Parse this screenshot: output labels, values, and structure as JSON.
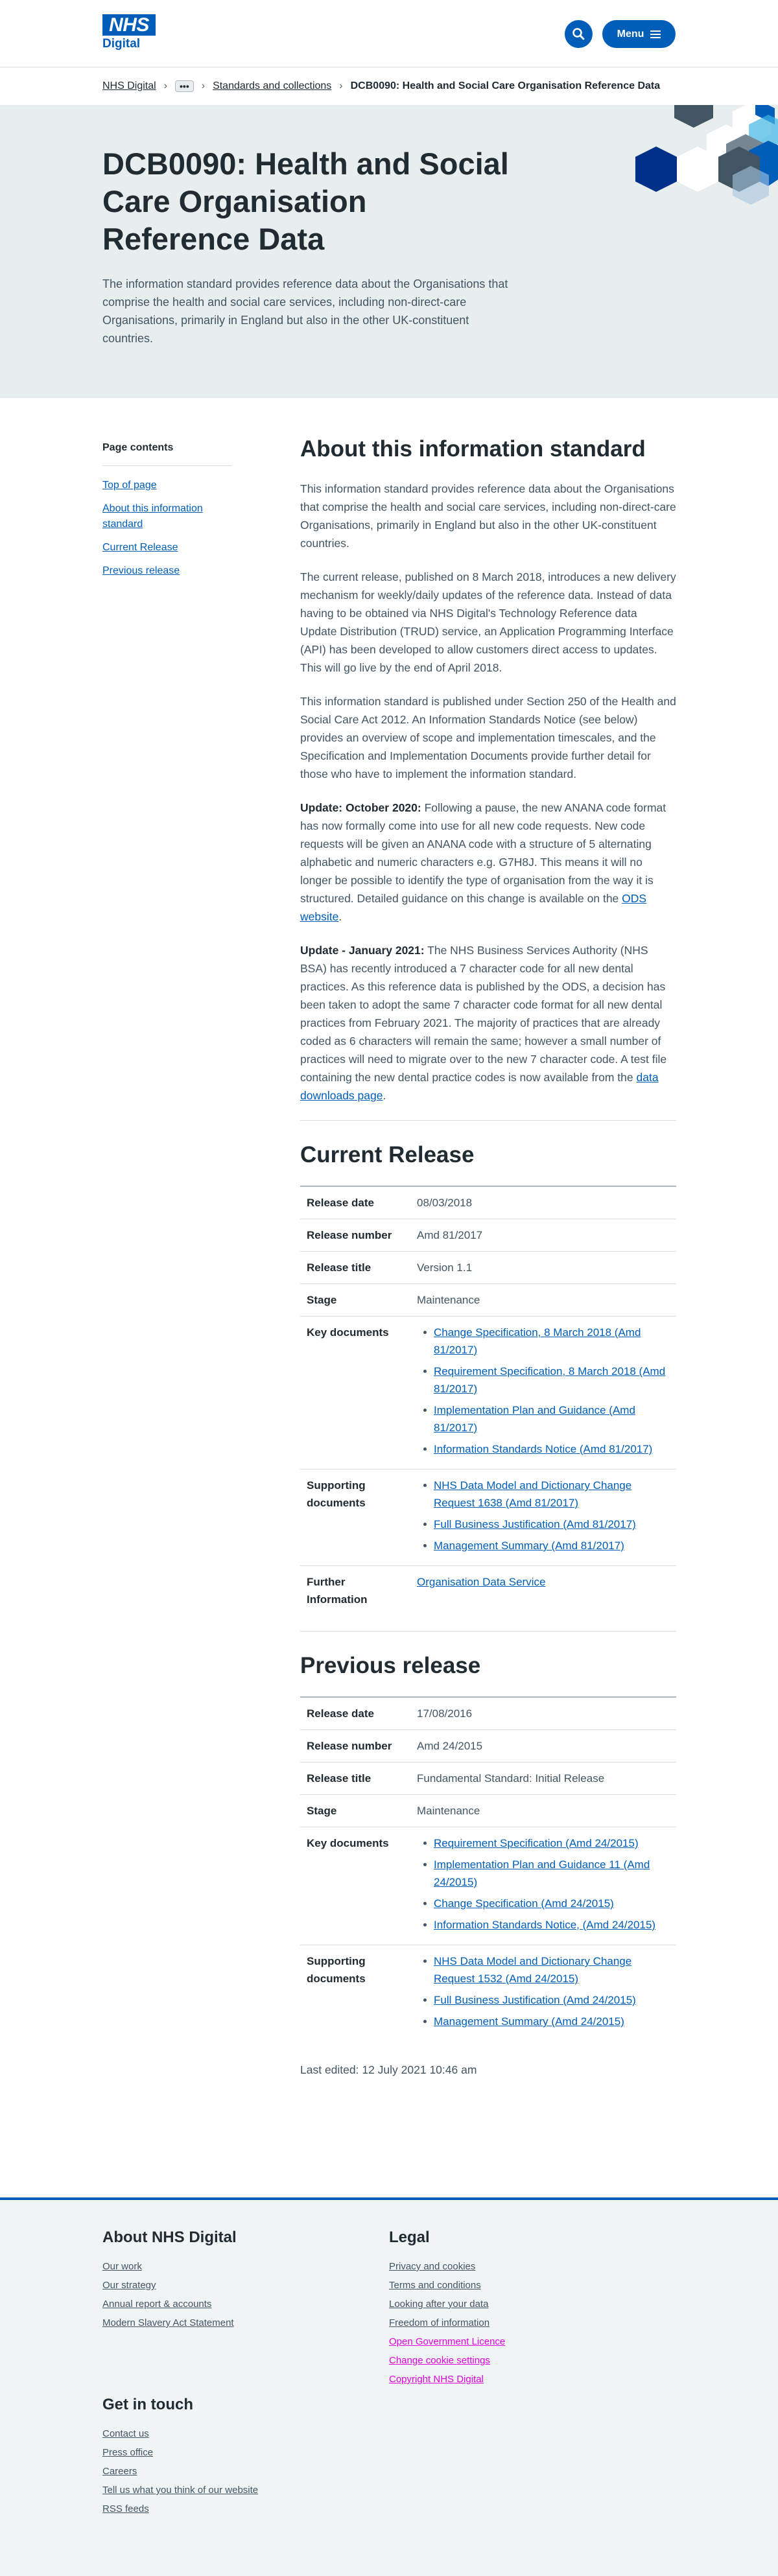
{
  "header": {
    "logo_text": "NHS",
    "logo_sub": "Digital",
    "menu_label": "Menu"
  },
  "breadcrumb": {
    "items": [
      "NHS Digital",
      "•••",
      "Standards and collections"
    ],
    "current": "DCB0090: Health and Social Care Organisation Reference Data"
  },
  "hero": {
    "title": "DCB0090: Health and Social Care Organisation Reference Data",
    "summary": "The information standard provides reference data about the Organisations that comprise the health and social care services, including non-direct-care Organisations, primarily in England but also in the other UK-constituent countries."
  },
  "sidebar": {
    "heading": "Page contents",
    "links": [
      "Top of page",
      "About this information standard",
      "Current Release",
      "Previous release"
    ]
  },
  "about": {
    "heading": "About this information standard",
    "p1": "This information standard provides reference data about the Organisations that comprise the health and social care services, including non-direct-care Organisations, primarily in England but also in the other UK-constituent countries.",
    "p2": "The current release, published on 8 March 2018, introduces a new delivery mechanism for weekly/daily updates of the reference data. Instead of data having to be obtained via NHS Digital's Technology Reference data Update Distribution (TRUD) service, an Application Programming Interface (API) has been developed to allow customers direct access to updates. This will go live by the end of April 2018.",
    "p3": "This information standard is published under Section 250 of the Health and Social Care Act 2012. An Information Standards Notice (see below) provides an overview of scope and implementation timescales, and the Specification and Implementation Documents provide further detail for those who have to implement the information standard.",
    "p4_label": "Update: October 2020:",
    "p4_text": "  Following a pause, the new ANANA code format has now formally come into use for all new code requests. New code requests will be given an ANANA code with a structure of 5 alternating alphabetic and numeric characters e.g. G7H8J. This means it will no longer be possible to identify the type of organisation from the way it is structured. Detailed guidance on this change is available on the ",
    "p4_link": "ODS website",
    "p4_end": ".",
    "p5_label": "Update - January 2021:",
    "p5_text": " The NHS Business Services Authority (NHS BSA) has recently introduced a 7 character code for all new dental practices. As this reference data is published by the ODS, a decision has been taken to adopt the same 7 character code format for all new dental practices from February 2021. The majority of practices that are already coded as 6 characters will remain the same; however a small number of practices will need to migrate over to the new 7 character code. A test file containing the new dental practice codes is now available from the ",
    "p5_link": "data downloads page",
    "p5_end": "."
  },
  "current_release": {
    "heading": "Current Release",
    "labels": {
      "release_date": "Release date",
      "release_number": "Release number",
      "release_title": "Release title",
      "stage": "Stage",
      "key_documents": "Key documents",
      "supporting_documents": "Supporting documents",
      "further_information": "Further Information"
    },
    "release_date": "08/03/2018",
    "release_number": "Amd 81/2017",
    "release_title": "Version 1.1",
    "stage": "Maintenance",
    "key_documents": [
      "Change Specification, 8 March 2018 (Amd 81/2017)",
      "Requirement Specification, 8 March 2018 (Amd 81/2017)",
      "Implementation Plan and Guidance (Amd 81/2017)",
      "Information Standards Notice (Amd 81/2017)"
    ],
    "supporting_documents": [
      "NHS Data Model and Dictionary Change Request 1638 (Amd 81/2017)",
      "Full Business Justification (Amd 81/2017)",
      "Management Summary (Amd 81/2017)"
    ],
    "further_information": "Organisation Data Service"
  },
  "previous_release": {
    "heading": "Previous release",
    "labels": {
      "release_date": "Release date",
      "release_number": "Release number",
      "release_title": "Release title",
      "stage": "Stage",
      "key_documents": "Key documents",
      "supporting_documents": "Supporting documents"
    },
    "release_date": "17/08/2016",
    "release_number": "Amd 24/2015",
    "release_title": "Fundamental Standard: Initial Release",
    "stage": "Maintenance",
    "key_documents": [
      "Requirement Specification (Amd 24/2015)",
      "Implementation Plan and Guidance 11 (Amd 24/2015)",
      "Change Specification (Amd 24/2015)",
      "Information Standards Notice, (Amd 24/2015)"
    ],
    "supporting_documents": [
      "NHS Data Model and Dictionary Change Request 1532 (Amd 24/2015)",
      "Full Business Justification (Amd 24/2015)",
      "Management Summary (Amd 24/2015)"
    ]
  },
  "last_edited": "Last edited: 12 July 2021 10:46 am",
  "footer": {
    "about_heading": "About NHS Digital",
    "about_links": [
      "Our work",
      "Our strategy",
      "Annual report & accounts",
      "Modern Slavery Act Statement"
    ],
    "legal_heading": "Legal",
    "legal_links": [
      "Privacy and cookies",
      "Terms and conditions",
      "Looking after your data",
      "Freedom of information"
    ],
    "legal_pink_links": [
      "Open Government Licence",
      "Change cookie settings",
      "Copyright NHS Digital"
    ],
    "contact_heading": "Get in touch",
    "contact_links": [
      "Contact us",
      "Press office",
      "Careers",
      "Tell us what you think of our website",
      "RSS feeds"
    ]
  },
  "colors": {
    "brand_blue": "#005eb8",
    "hero_bg": "#e8edee",
    "footer_bg": "#f0f4f5"
  }
}
